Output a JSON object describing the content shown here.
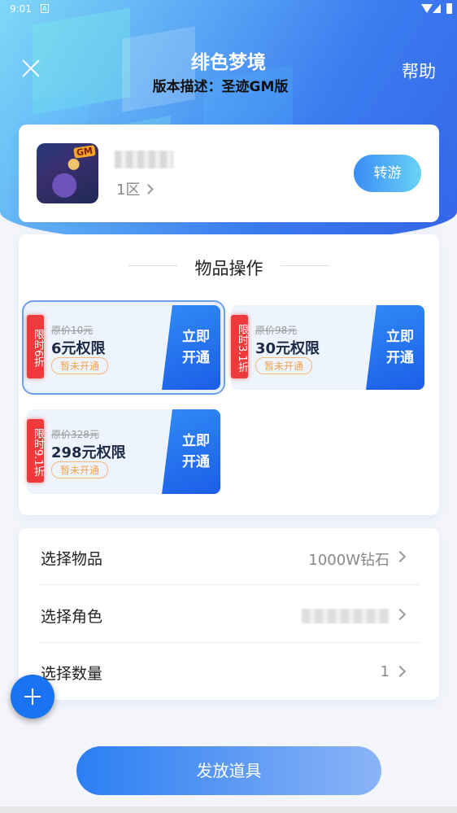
{
  "status_bar": {
    "time": "9:01",
    "a_icon": "A"
  },
  "header": {
    "title": "绯色梦境",
    "subtitle": "版本描述：圣迹GM版",
    "help_label": "帮助"
  },
  "game": {
    "icon_badge": "GM",
    "server": "1区",
    "transfer_label": "转游"
  },
  "items_section": {
    "title": "物品操作",
    "offers": [
      {
        "tag": "限时6折",
        "original_price": "原价10元",
        "price": "6元权限",
        "state": "暂未开通",
        "action": "立即开通"
      },
      {
        "tag": "限时3.1折",
        "original_price": "原价98元",
        "price": "30元权限",
        "state": "暂未开通",
        "action": "立即开通"
      },
      {
        "tag": "限时9.1折",
        "original_price": "原价328元",
        "price": "298元权限",
        "state": "暂未开通",
        "action": "立即开通"
      }
    ]
  },
  "selectors": {
    "item": {
      "label": "选择物品",
      "value": "1000W钻石"
    },
    "role": {
      "label": "选择角色"
    },
    "quantity": {
      "label": "选择数量",
      "value": "1"
    }
  },
  "submit_label": "发放道具"
}
